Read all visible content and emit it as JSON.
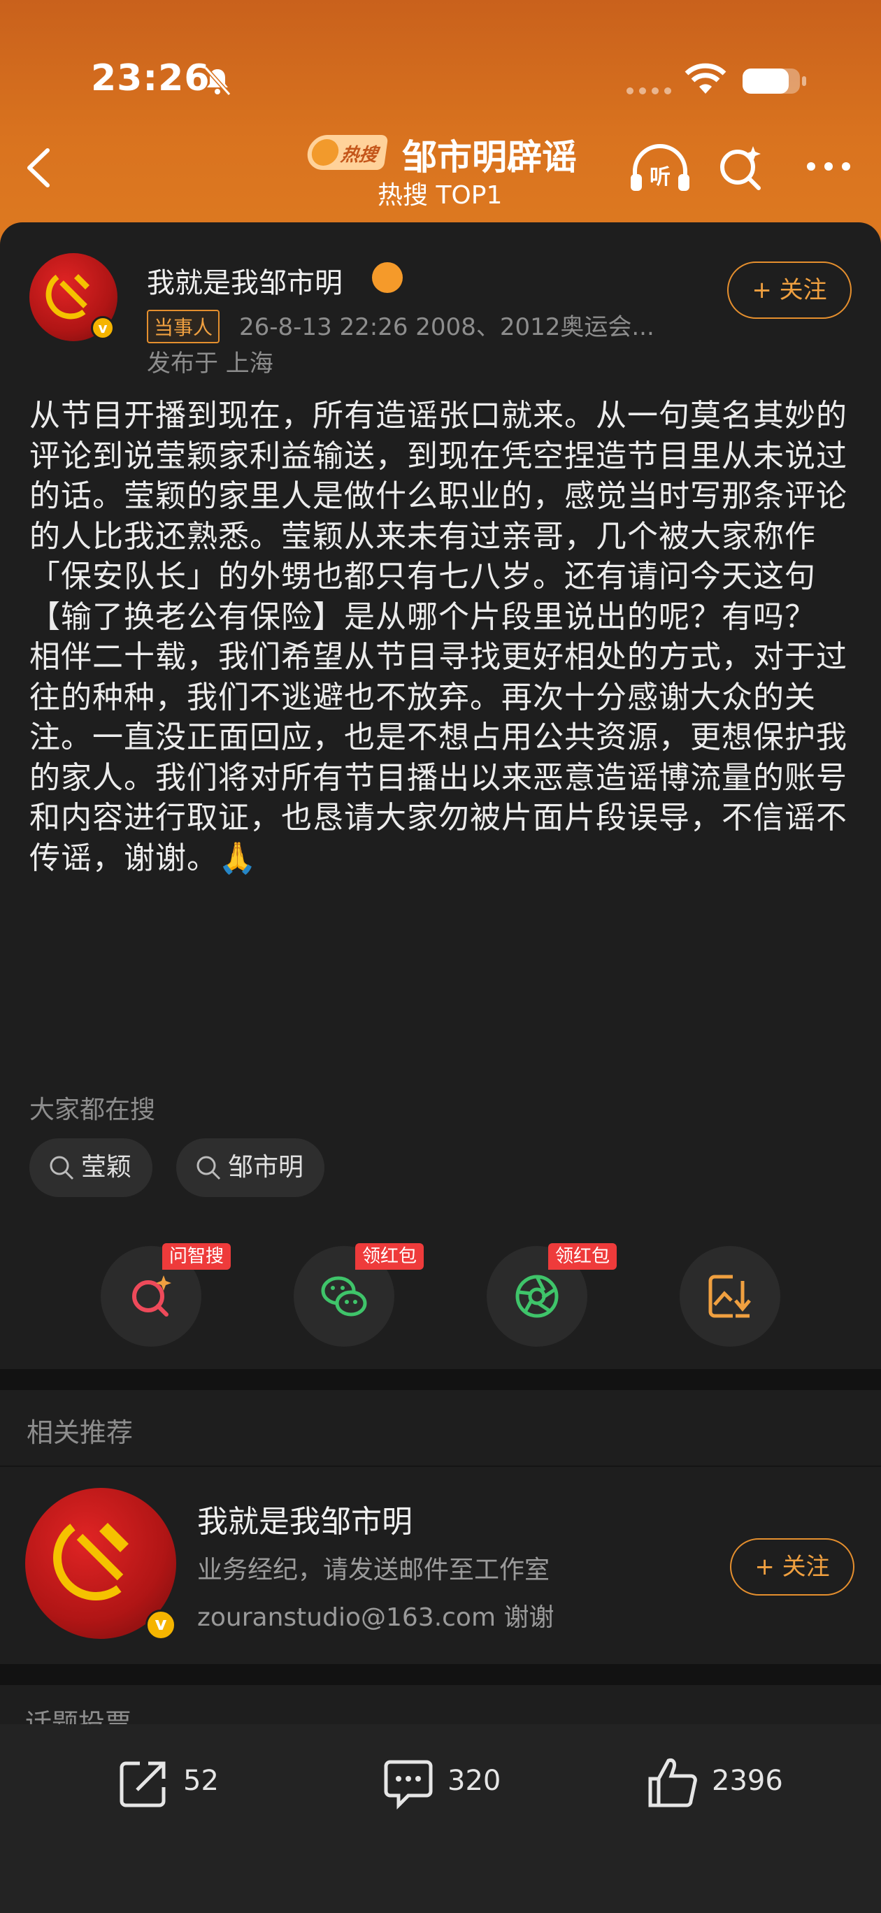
{
  "status_bar": {
    "time": "23:26"
  },
  "header": {
    "hot_badge": "热搜",
    "title": "邹市明辟谣",
    "subtitle": "热搜 TOP1",
    "listen_label": "听"
  },
  "post": {
    "author": "我就是我邹市明",
    "tag": "当事人",
    "meta": "26-8-13 22:26  2008、2012奥运会...",
    "location": "发布于 上海",
    "follow_label": "+ 关注",
    "body": "从节目开播到现在，所有造谣张口就来。从一句莫名其妙的评论到说莹颖家利益输送，到现在凭空捏造节目里从未说过的话。莹颖的家里人是做什么职业的，感觉当时写那条评论的人比我还熟悉。莹颖从来未有过亲哥，几个被大家称作「保安队长」的外甥也都只有七八岁。还有请问今天这句【输了换老公有保险】是从哪个片段里说出的呢？有吗？\n相伴二十载，我们希望从节目寻找更好相处的方式，对于过往的种种，我们不逃避也不放弃。再次十分感谢大众的关注。一直没正面回应，也是不想占用公共资源，更想保护我的家人。我们将对所有节目播出以来恶意造谣博流量的账号和内容进行取证，也恳请大家勿被片面片段误导，不信谣不传谣，谢谢。🙏"
  },
  "search_section": {
    "heading": "大家都在搜",
    "chips": [
      "莹颖",
      "邹市明"
    ]
  },
  "actions": {
    "tags": [
      "问智搜",
      "领红包",
      "领红包"
    ]
  },
  "related": {
    "title": "相关推荐",
    "name": "我就是我邹市明",
    "desc1": "业务经纪，请发送邮件至工作室",
    "desc2": "zouranstudio@163.com 谢谢",
    "follow_label": "+ 关注",
    "next_section_title": "话题投票"
  },
  "bottom_bar": {
    "share_count": "52",
    "comment_count": "320",
    "like_count": "2396"
  },
  "colors": {
    "header_orange": "#d9731f",
    "accent": "#e58f2e",
    "badge_red": "#ee3b3b"
  }
}
